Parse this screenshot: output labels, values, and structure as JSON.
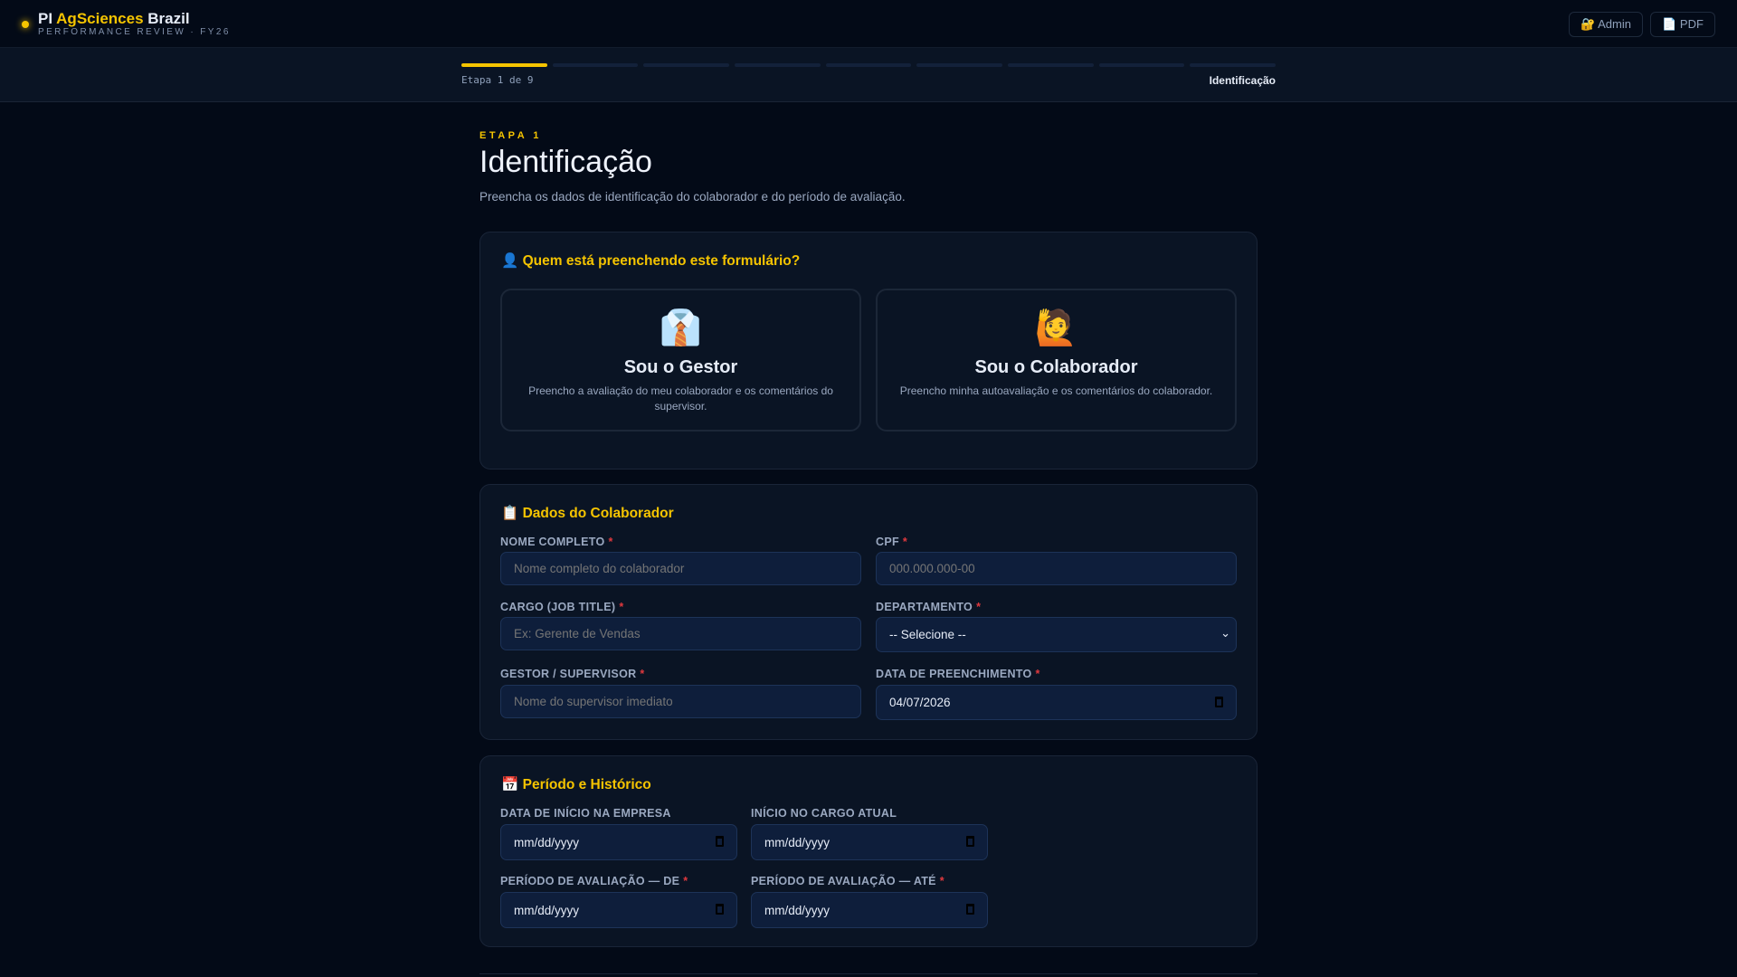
{
  "header": {
    "brand_pre": "PI ",
    "brand_accent": "AgSciences",
    "brand_post": " Brazil",
    "subtitle": "PERFORMANCE REVIEW · FY26",
    "admin_label": "🔐 Admin",
    "pdf_label": "📄 PDF"
  },
  "progress": {
    "current_step": 1,
    "total_steps": 9,
    "label": "Etapa 1 de 9",
    "step_name": "Identificação"
  },
  "page": {
    "eyebrow": "ETAPA 1",
    "title": "Identificação",
    "description": "Preencha os dados de identificação do colaborador e do período de avaliação."
  },
  "who": {
    "heading": "👤 Quem está preenchendo este formulário?",
    "options": [
      {
        "emoji": "👔",
        "title": "Sou o Gestor",
        "desc": "Preencho a avaliação do meu colaborador e os comentários do supervisor."
      },
      {
        "emoji": "🙋",
        "title": "Sou o Colaborador",
        "desc": "Preencho minha autoavaliação e os comentários do colaborador."
      }
    ]
  },
  "dados": {
    "heading": "📋 Dados do Colaborador",
    "fields": [
      {
        "label": "NOME COMPLETO",
        "required": "*",
        "placeholder": "Nome completo do colaborador"
      },
      {
        "label": "CPF",
        "required": "*",
        "placeholder": "000.000.000-00"
      },
      {
        "label": "CARGO (JOB TITLE)",
        "required": "*",
        "placeholder": "Ex: Gerente de Vendas"
      },
      {
        "label": "DEPARTAMENTO",
        "required": "*",
        "value": "-- Selecione --"
      },
      {
        "label": "GESTOR / SUPERVISOR",
        "required": "*",
        "placeholder": "Nome do supervisor imediato"
      },
      {
        "label": "DATA DE PREENCHIMENTO",
        "required": "*",
        "value": "04/07/2026"
      }
    ]
  },
  "periodo": {
    "heading": "📅 Período e Histórico",
    "fields": [
      {
        "label": "DATA DE INÍCIO NA EMPRESA",
        "value": "mm/dd/yyyy"
      },
      {
        "label": "INÍCIO NO CARGO ATUAL",
        "value": "mm/dd/yyyy"
      },
      {
        "label": "PERÍODO DE AVALIAÇÃO — DE",
        "required": "*",
        "value": "mm/dd/yyyy"
      },
      {
        "label": "PERÍODO DE AVALIAÇÃO — ATÉ",
        "required": "*",
        "value": "mm/dd/yyyy"
      }
    ]
  }
}
